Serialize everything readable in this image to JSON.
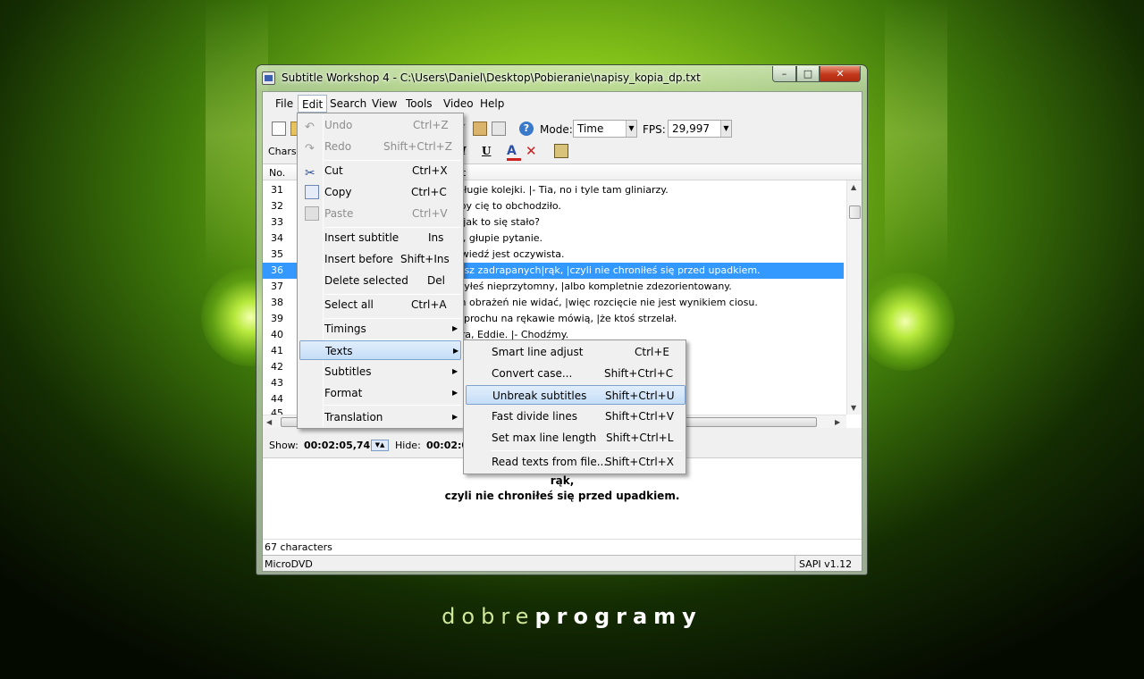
{
  "desktop": {
    "brand_light": "dobre",
    "brand_bold": "programy"
  },
  "window": {
    "title": "Subtitle Workshop 4 - C:\\Users\\Daniel\\Desktop\\Pobieranie\\napisy_kopia_dp.txt",
    "menubar": [
      "File",
      "Edit",
      "Search",
      "View",
      "Tools",
      "Video",
      "Help"
    ],
    "toolbar": {
      "mode_label": "Mode:",
      "mode_value": "Time",
      "fps_label": "FPS:",
      "fps_value": "29,997",
      "charset_label": "Charse"
    },
    "list": {
      "col_no": "No.",
      "col_text": "t",
      "rows": [
        {
          "num": "31",
          "text": "a długie kolejki. |- Tia, no i tyle tam gliniarzy."
        },
        {
          "num": "32",
          "text": "żeby cię to obchodziło."
        },
        {
          "num": "33",
          "text": "ąc jak to się stało?"
        },
        {
          "num": "34",
          "text": "cja, głupie pytanie."
        },
        {
          "num": "35",
          "text": "powiedź jest oczywista."
        },
        {
          "num": "36",
          "text": "masz zadrapanych|rąk, |czyli nie chroniłeś się przed upadkiem."
        },
        {
          "num": "37",
          "text": "o byłeś nieprzytomny, |albo kompletnie zdezorientowany."
        },
        {
          "num": "38",
          "text": "ych obrażeń nie widać, |więc rozcięcie nie jest wynikiem ciosu."
        },
        {
          "num": "39",
          "text": "dy prochu na rękawie mówią, |że ktoś strzelał."
        },
        {
          "num": "40",
          "text": "obra, Eddie. |- Chodźmy."
        },
        {
          "num": "41",
          "text": ""
        },
        {
          "num": "42",
          "text": ""
        },
        {
          "num": "43",
          "text": ""
        },
        {
          "num": "44",
          "text": ""
        },
        {
          "num": "45",
          "text": ""
        }
      ],
      "selected_row": "36"
    },
    "timebar": {
      "show_label": "Show:",
      "show_value": "00:02:05,746",
      "hide_label": "Hide:",
      "hide_value": "00:02:0"
    },
    "editor": {
      "line1": "rąk,",
      "line2": "czyli nie chroniłeś się przed upadkiem."
    },
    "status": {
      "chars": "67 characters",
      "format": "MicroDVD",
      "sapi": "SAPI v1.12"
    }
  },
  "edit_menu": {
    "items": [
      {
        "label": "Undo",
        "key": "Ctrl+Z",
        "disabled": true
      },
      {
        "label": "Redo",
        "key": "Shift+Ctrl+Z",
        "disabled": true
      },
      {
        "label": "Cut",
        "key": "Ctrl+X"
      },
      {
        "label": "Copy",
        "key": "Ctrl+C"
      },
      {
        "label": "Paste",
        "key": "Ctrl+V",
        "disabled": true
      },
      {
        "label": "Insert subtitle",
        "key": "Ins"
      },
      {
        "label": "Insert before",
        "key": "Shift+Ins"
      },
      {
        "label": "Delete selected",
        "key": "Del"
      },
      {
        "label": "Select all",
        "key": "Ctrl+A"
      },
      {
        "label": "Timings",
        "key": ""
      },
      {
        "label": "Texts",
        "key": ""
      },
      {
        "label": "Subtitles",
        "key": ""
      },
      {
        "label": "Format",
        "key": ""
      },
      {
        "label": "Translation",
        "key": ""
      }
    ]
  },
  "texts_submenu": {
    "items": [
      {
        "label": "Smart line adjust",
        "key": "Ctrl+E"
      },
      {
        "label": "Convert case...",
        "key": "Shift+Ctrl+C"
      },
      {
        "label": "Unbreak subtitles",
        "key": "Shift+Ctrl+U"
      },
      {
        "label": "Fast divide lines",
        "key": "Shift+Ctrl+V"
      },
      {
        "label": "Set max line length",
        "key": "Shift+Ctrl+L"
      },
      {
        "label": "Read texts from file...",
        "key": "Shift+Ctrl+X"
      }
    ]
  },
  "colors": {
    "selection": "#3399ff",
    "menu_highlight": "#c5ddf7",
    "close_button": "#c2371a"
  }
}
